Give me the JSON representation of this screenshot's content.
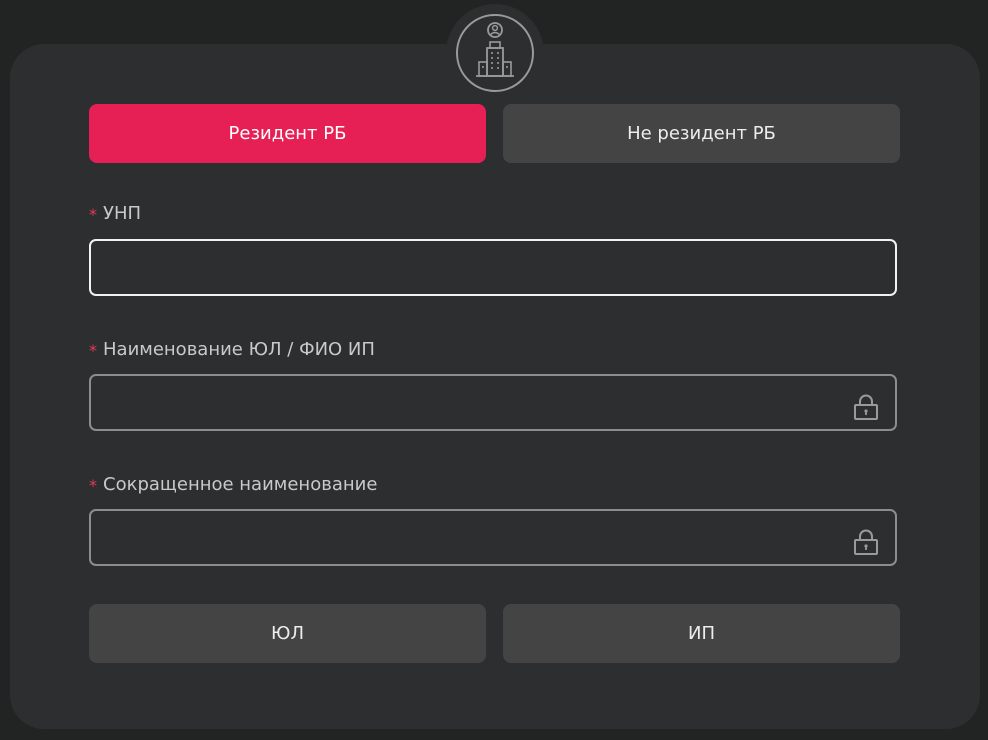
{
  "header": {
    "avatar_icon": "company-building-icon"
  },
  "residency": {
    "options": [
      {
        "label": "Резидент РБ",
        "active": true
      },
      {
        "label": "Не резидент РБ",
        "active": false
      }
    ],
    "accent_color": "#e61f55"
  },
  "form": {
    "required_marker": "*",
    "fields": [
      {
        "label": "УНП",
        "value": "",
        "locked": false
      },
      {
        "label": "Наименование ЮЛ / ФИО ИП",
        "value": "",
        "locked": true,
        "icon": "lock-icon"
      },
      {
        "label": "Сокращенное наименование",
        "value": "",
        "locked": true,
        "icon": "lock-icon"
      }
    ]
  },
  "entity_type": {
    "options": [
      {
        "label": "ЮЛ"
      },
      {
        "label": "ИП"
      }
    ]
  }
}
